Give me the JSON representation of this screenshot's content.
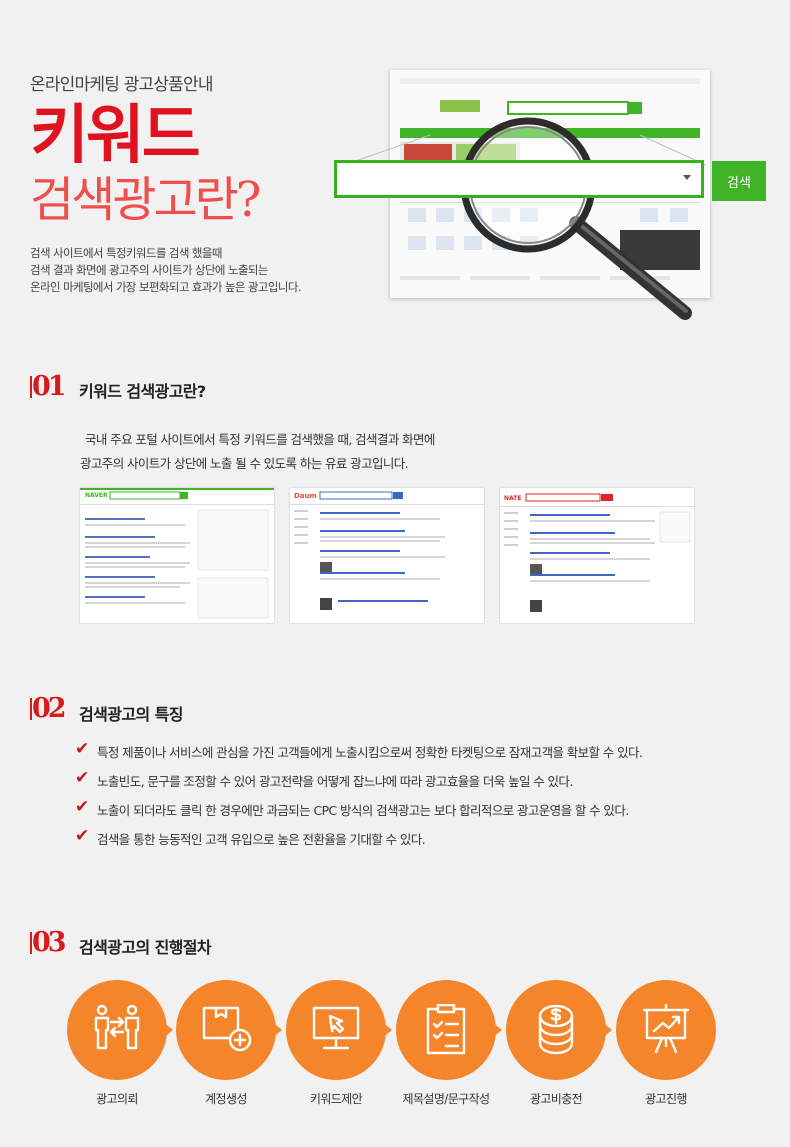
{
  "hero": {
    "subtitle": "온라인마케팅 광고상품안내",
    "title_line1": "키워드",
    "title_line2": "검색광고란?",
    "description": [
      "검색 사이트에서  특정키워드를 검색 했을때",
      "검색 결과 화면에 광고주의 사이트가 상단에 노출되는",
      "온라인 마케팅에서 가장 보편화되고 효과가 높은 광고입니다."
    ],
    "search_button": "검색",
    "accent_green": "#3eb426"
  },
  "section1": {
    "number": "01",
    "title": "키워드 검색광고란?",
    "body": [
      "국내 주요 포털 사이트에서 특정 키워드를 검색했을 때, 검색결과 화면에",
      "광고주의 사이트가 상단에 노출 될 수 있도록 하는 유료 광고입니다."
    ],
    "portals": [
      "NAVER",
      "Daum",
      "NATE"
    ]
  },
  "section2": {
    "number": "02",
    "title": "검색광고의 특징",
    "features": [
      "특정 제품이나 서비스에 관심을 가진 고객들에게 노출시킴으로써 정확한 타켓팅으로 잠재고객을 확보할 수 있다.",
      "노출빈도, 문구를 조정할 수 있어 광고전략을 어떻게 잡느냐에 따라 광고효율을 더욱 높일 수 있다.",
      "노출이 되더라도 클릭 한 경우에만 과금되는 CPC 방식의 검색광고는 보다 합리적으로 광고운영을 할 수 있다.",
      "검색을 통한 능동적인 고객 유입으로 높은 전환율을 기대할 수 있다."
    ]
  },
  "section3": {
    "number": "03",
    "title": "검색광고의 진행절차",
    "accent_orange": "#f5852a",
    "steps": [
      {
        "label": "광고의뢰",
        "icon": "people-exchange-icon"
      },
      {
        "label": "계정생성",
        "icon": "box-add-icon"
      },
      {
        "label": "키워드제안",
        "icon": "monitor-cursor-icon"
      },
      {
        "label": "제목설명/문구작성",
        "icon": "checklist-icon"
      },
      {
        "label": "광고비충전",
        "icon": "coins-stack-icon"
      },
      {
        "label": "광고진행",
        "icon": "presentation-chart-icon"
      }
    ]
  }
}
